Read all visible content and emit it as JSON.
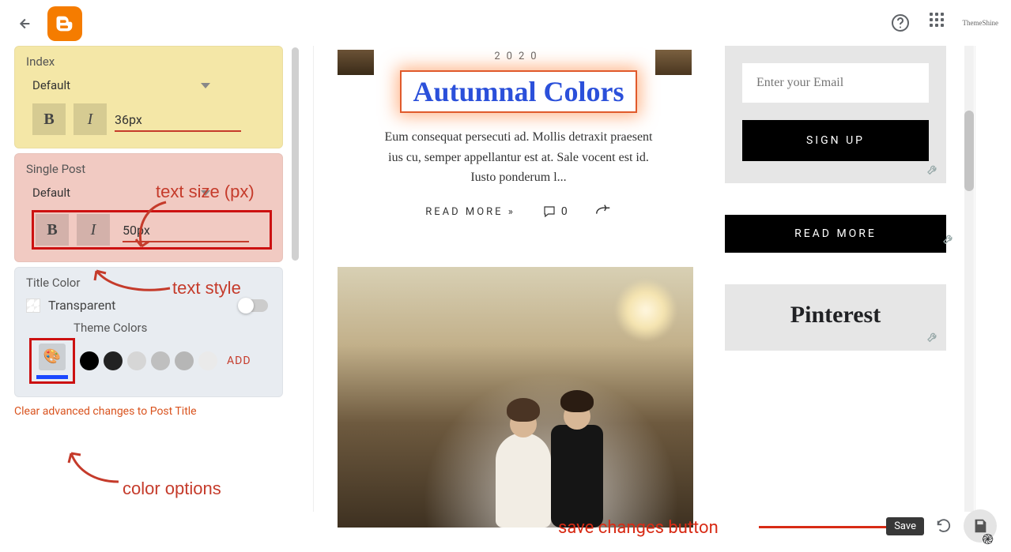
{
  "header": {
    "brand_label": "ThemeShine"
  },
  "panel": {
    "index": {
      "label": "Index",
      "font_family": "Default",
      "size_value": "36px"
    },
    "single_post": {
      "label": "Single Post",
      "font_family": "Default",
      "size_value": "50px"
    },
    "title_color": {
      "label": "Title Color",
      "transparent_label": "Transparent",
      "theme_colors_label": "Theme Colors",
      "add_label": "ADD",
      "swatches": [
        "#000000",
        "#222222",
        "#d6d6d6",
        "#bfbfbf",
        "#b6b6b6",
        "#eaeaea"
      ]
    },
    "clear_link": "Clear advanced changes to Post Title"
  },
  "annotations": {
    "text_size": "text size (px)",
    "text_style": "text style",
    "color_options": "color options",
    "save_changes": "save changes button"
  },
  "preview": {
    "year": "2020",
    "title": "Autumnal Colors",
    "excerpt": "Eum consequat persecuti ad. Mollis detraxit praesent ius cu, semper appellantur est at. Sale vocent est id. Iusto ponderum l...",
    "read_more": "READ MORE »",
    "comment_count": "0",
    "sidebar": {
      "email_placeholder": "Enter your Email",
      "signup_label": "SIGN UP",
      "readmore_label": "READ MORE",
      "pinterest_label": "Pinterest"
    }
  },
  "save": {
    "tooltip": "Save"
  }
}
